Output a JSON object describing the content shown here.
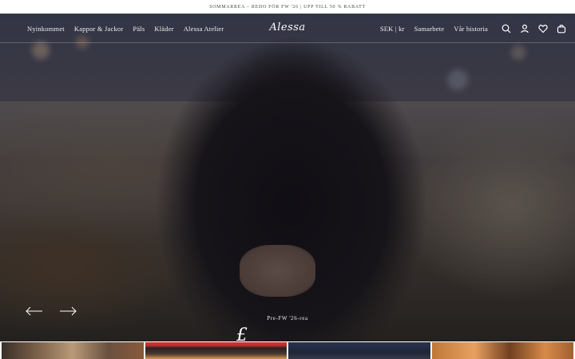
{
  "announcement": "SOMMARREA – REDO FÖR FW '26 | UPP TILL 50 % RABATT",
  "nav": {
    "left_links": [
      "Nyinkommet",
      "Kappor & Jackor",
      "Päls",
      "Kläder",
      "Alessa Atelier"
    ],
    "logo": "Alessa",
    "currency": "SEK | kr",
    "right_links": [
      "Samarbete",
      "Vår historia"
    ],
    "icons": [
      "search-icon",
      "account-icon",
      "heart-icon",
      "bag-icon"
    ]
  },
  "hero": {
    "caption": "Pre-FW '26-rea",
    "script_glyph": "£"
  },
  "colors": {
    "text_on_hero": "#ffffff",
    "announcement_text": "#4a4a4a"
  }
}
